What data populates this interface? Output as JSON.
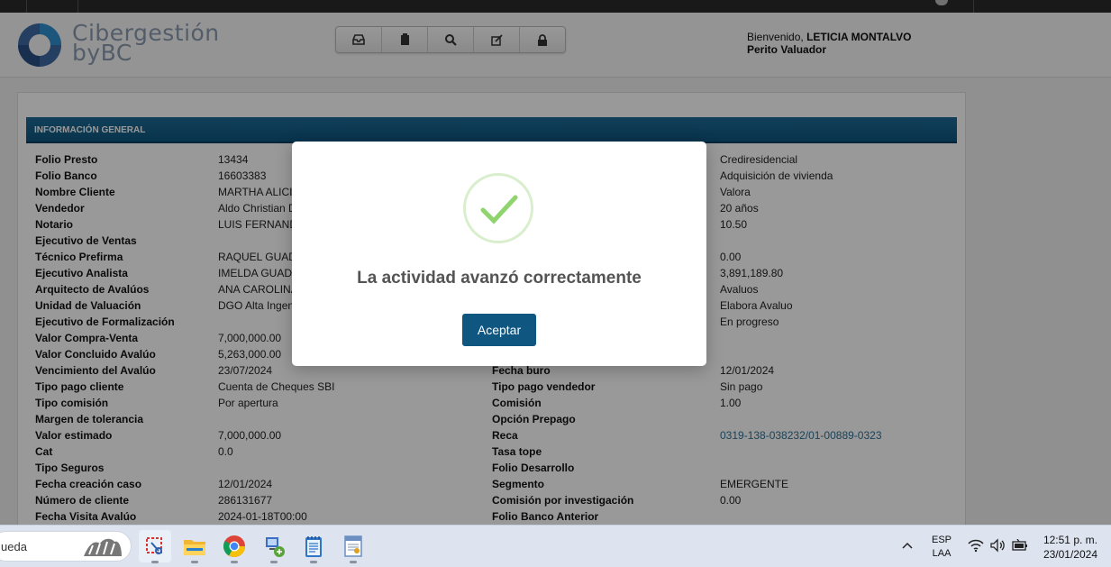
{
  "header": {
    "brand_line1": "Cibergestión",
    "brand_line2": "byBC",
    "welcome_prefix": "Bienvenido,",
    "user_name": "LETICIA MONTALVO",
    "user_role": "Perito Valuador",
    "toolbar_icons": [
      "inbox-icon",
      "clipboard-icon",
      "search-icon",
      "edit-icon",
      "lock-icon"
    ]
  },
  "section": {
    "title": "INFORMACIÓN GENERAL"
  },
  "rows": [
    {
      "l1": "Folio Presto",
      "v1": "13434",
      "l2": "",
      "v2": "Crediresidencial"
    },
    {
      "l1": "Folio Banco",
      "v1": "16603383",
      "l2": "",
      "v2": "Adquisición de vivienda"
    },
    {
      "l1": "Nombre Cliente",
      "v1": "MARTHA ALICIA",
      "l2": "",
      "v2": "Valora"
    },
    {
      "l1": "Vendedor",
      "v1": "Aldo Christian D",
      "l2": "",
      "v2": "20 años"
    },
    {
      "l1": "Notario",
      "v1": "LUIS FERNAND",
      "l2": "",
      "v2": "10.50"
    },
    {
      "l1": "Ejecutivo de Ventas",
      "v1": "",
      "l2": "",
      "v2": ""
    },
    {
      "l1": "Técnico Prefirma",
      "v1": "RAQUEL GUAD",
      "l2": "",
      "v2": "0.00"
    },
    {
      "l1": "Ejecutivo Analista",
      "v1": "IMELDA GUADA",
      "l2": "",
      "v2": "3,891,189.80"
    },
    {
      "l1": "Arquitecto de Avalúos",
      "v1": "ANA CAROLINA",
      "l2": "",
      "v2": "Avaluos"
    },
    {
      "l1": "Unidad de Valuación",
      "v1": "DGO Alta Ingen",
      "l2": "",
      "v2": "Elabora Avaluo"
    },
    {
      "l1": "Ejecutivo de Formalización",
      "v1": "",
      "l2": "",
      "v2": "En progreso"
    },
    {
      "l1": "Valor Compra-Venta",
      "v1": "7,000,000.00",
      "l2": "",
      "v2": ""
    },
    {
      "l1": "Valor Concluido Avalúo",
      "v1": "5,263,000.00",
      "l2": "",
      "v2": ""
    },
    {
      "l1": "Vencimiento del Avalúo",
      "v1": "23/07/2024",
      "l2": "Fecha buro",
      "v2": "12/01/2024"
    },
    {
      "l1": "Tipo pago cliente",
      "v1": "Cuenta de Cheques SBI",
      "l2": "Tipo pago vendedor",
      "v2": "Sin pago"
    },
    {
      "l1": "Tipo comisión",
      "v1": "Por apertura",
      "l2": "Comisión",
      "v2": "1.00"
    },
    {
      "l1": "Margen de tolerancia",
      "v1": "",
      "l2": "Opción Prepago",
      "v2": ""
    },
    {
      "l1": "Valor estimado",
      "v1": "7,000,000.00",
      "l2": "Reca",
      "v2": "0319-138-038232/01-00889-0323",
      "link": true
    },
    {
      "l1": "Cat",
      "v1": "0.0",
      "l2": "Tasa tope",
      "v2": ""
    },
    {
      "l1": "Tipo Seguros",
      "v1": "",
      "l2": "Folio Desarrollo",
      "v2": ""
    },
    {
      "l1": "Fecha creación caso",
      "v1": "12/01/2024",
      "l2": "Segmento",
      "v2": "EMERGENTE"
    },
    {
      "l1": "Número de cliente",
      "v1": "286131677",
      "l2": "Comisión por investigación",
      "v2": "0.00"
    },
    {
      "l1": "Fecha Visita Avalúo",
      "v1": "2024-01-18T00:00",
      "l2": "Folio Banco Anterior",
      "v2": ""
    }
  ],
  "modal": {
    "icon": "success-check-icon",
    "message": "La actividad avanzó correctamente",
    "accept_label": "Aceptar",
    "accent_color": "#0f5680",
    "check_color": "#8fd46e"
  },
  "taskbar": {
    "search_placeholder": "ueda",
    "apps": [
      "snipping-tool-icon",
      "file-explorer-icon",
      "chrome-icon",
      "network-app-icon",
      "notepad-icon",
      "document-app-icon"
    ],
    "lang_line1": "ESP",
    "lang_line2": "LAA",
    "time": "12:51 p. m.",
    "date": "23/01/2024"
  }
}
